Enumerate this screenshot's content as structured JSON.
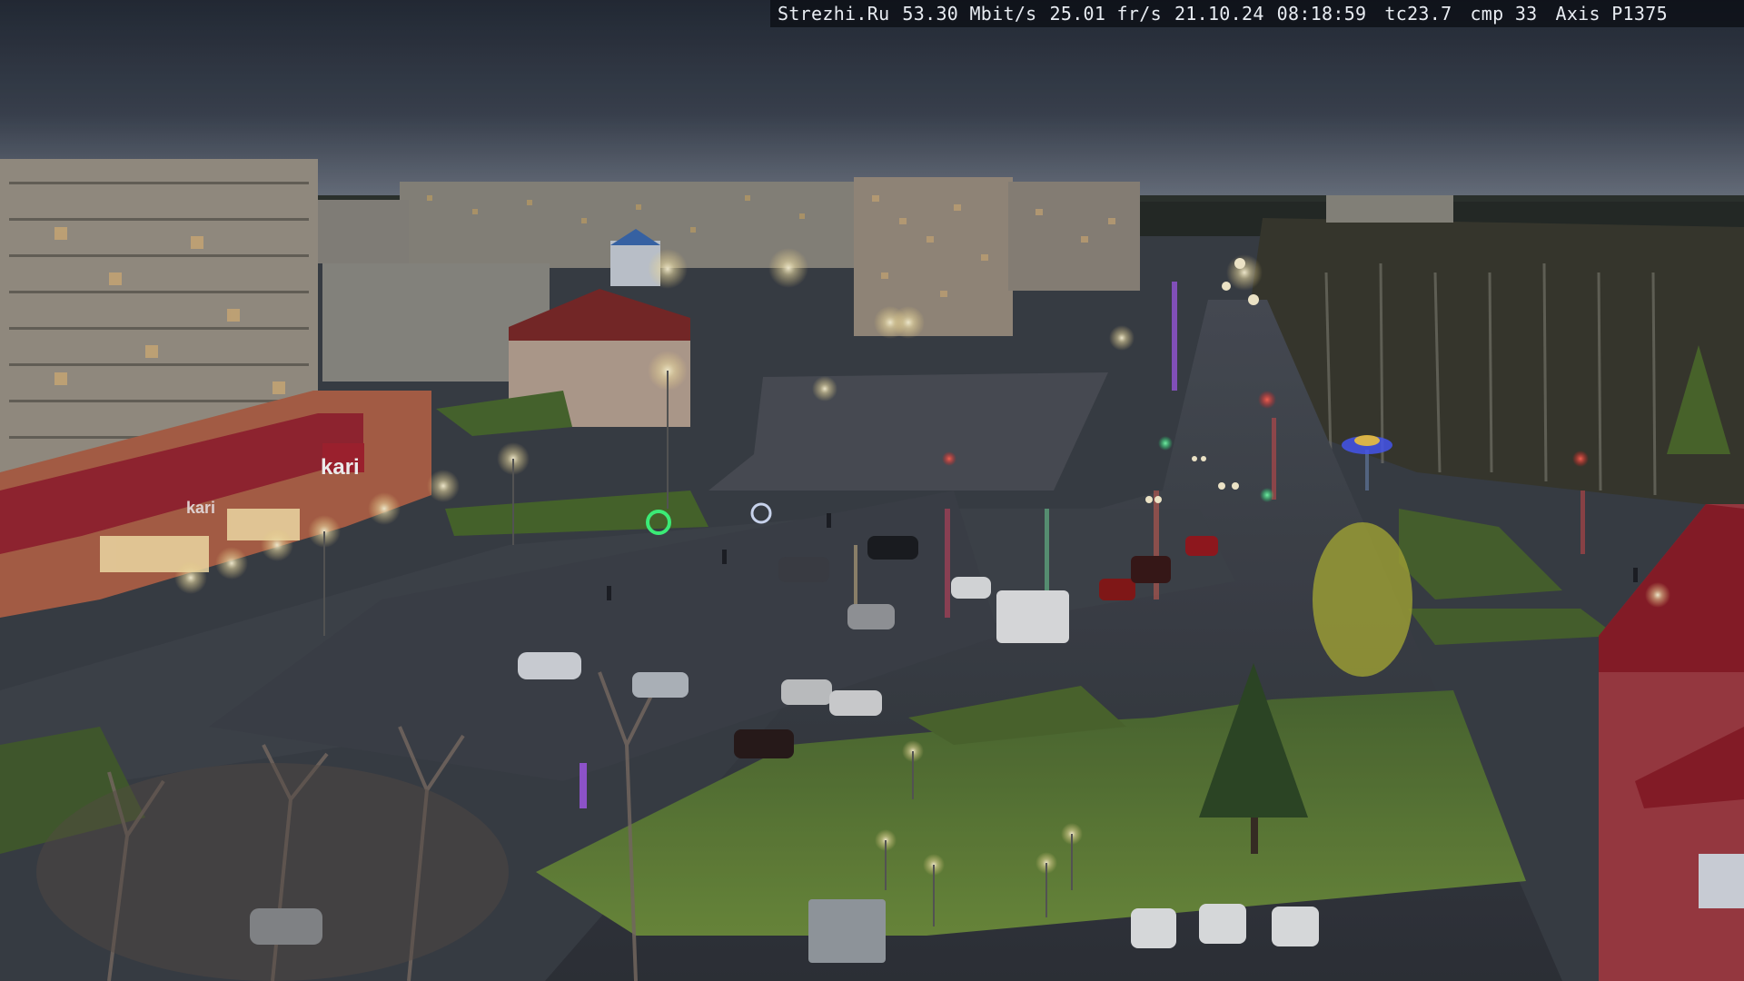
{
  "overlay": {
    "site": "Strezhi.Ru",
    "bitrate": "53.30 Mbit/s",
    "fps": "25.01 fr/s",
    "date": "21.10.24",
    "time": "08:18:59",
    "tc": "tc23.7",
    "cmp": "cmp 33",
    "camera": "Axis P1375"
  },
  "signs": {
    "store_logo": "kari",
    "store_banner": "kari"
  },
  "colors": {
    "sky_top": "#262d3a",
    "sky_horizon": "#6e7787",
    "asphalt": "#3a3f47",
    "grass": "#5a7a3a",
    "building_red": "#9a2a34",
    "lamp": "#fff6d6"
  }
}
